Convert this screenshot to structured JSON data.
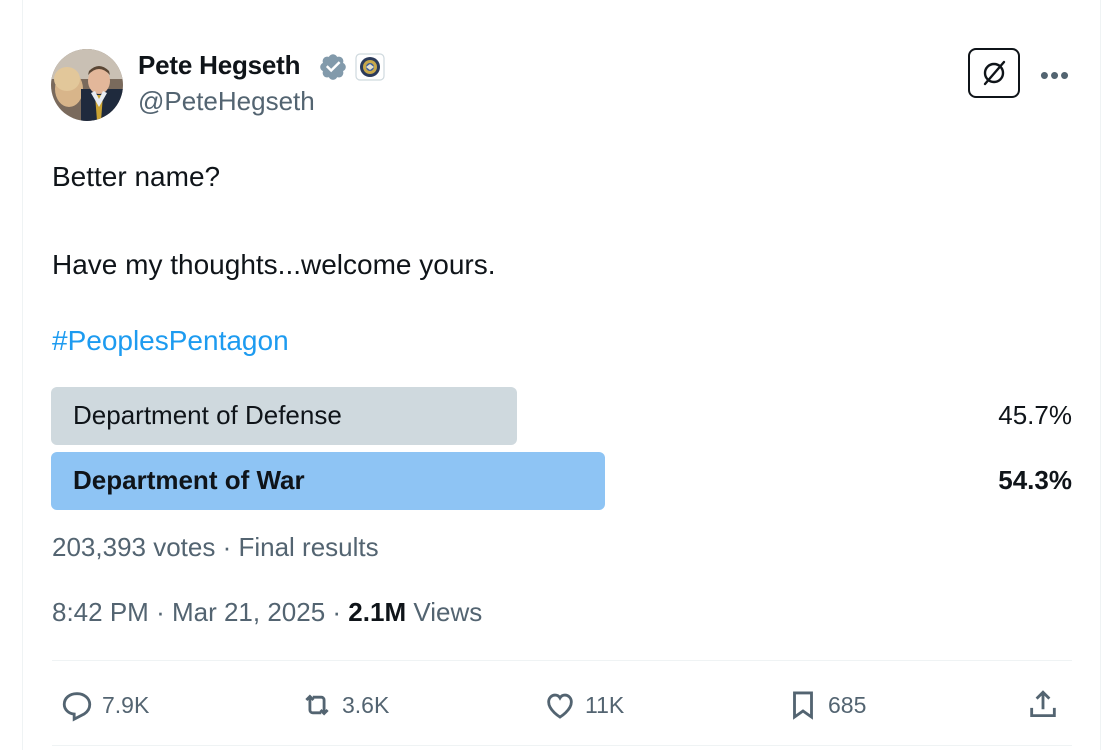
{
  "author": {
    "name": "Pete Hegseth",
    "handle": "@PeteHegseth",
    "verified_icon": "verified-badge-icon",
    "affiliate_icon": "dod-seal-icon"
  },
  "tweet": {
    "text": "Better name?\n\nHave my thoughts...welcome yours.",
    "hashtag": "#PeoplesPentagon"
  },
  "poll": {
    "options": [
      {
        "label": "Department of Defense",
        "percent": "45.7%",
        "fill_fraction": 0.457,
        "winner": false
      },
      {
        "label": "Department of War",
        "percent": "54.3%",
        "fill_fraction": 0.543,
        "winner": true
      }
    ],
    "summary": "203,393 votes · Final results"
  },
  "meta": {
    "time": "8:42 PM",
    "date": "Mar 21, 2025",
    "views_count": "2.1M",
    "views_label": "Views"
  },
  "actions": {
    "replies": "7.9K",
    "reposts": "3.6K",
    "likes": "11K",
    "bookmarks": "685"
  },
  "colors": {
    "accent": "#1d9bf0",
    "winner_bar": "#8ec4f4",
    "loser_bar": "#cfd9de",
    "secondary_text": "#536471"
  }
}
